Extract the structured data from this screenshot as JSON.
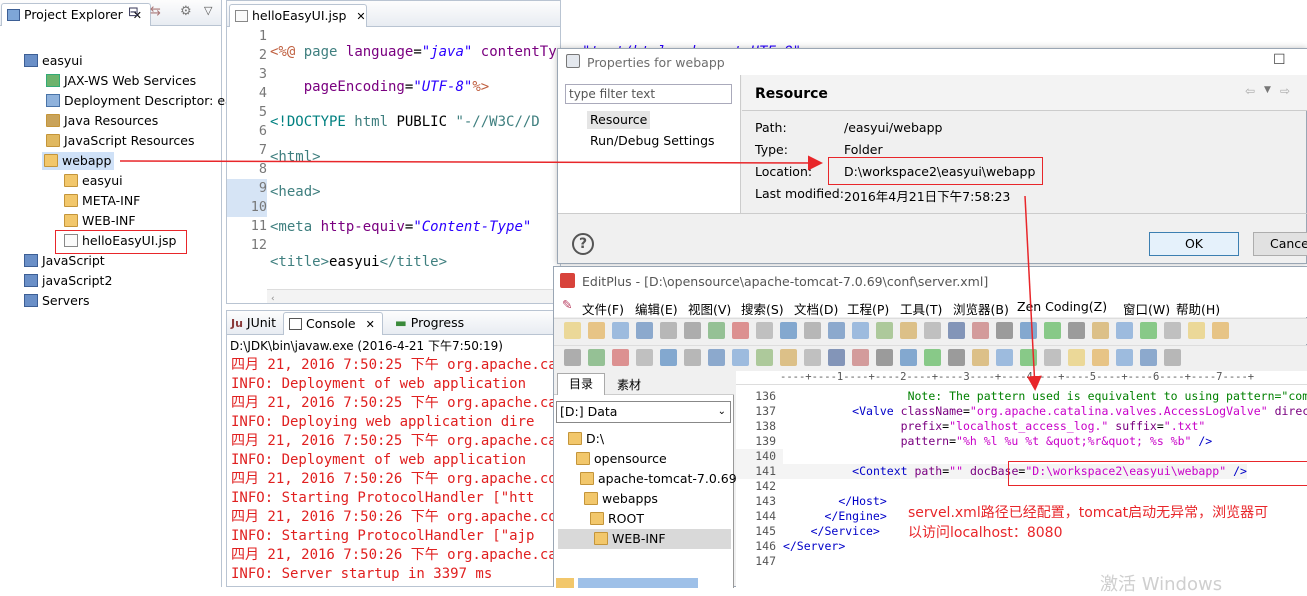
{
  "project_explorer": {
    "tab": "Project Explorer",
    "items": [
      {
        "label": "easyui",
        "icon": "project-icon"
      },
      {
        "label": "JAX-WS Web Services",
        "icon": "webservices-icon"
      },
      {
        "label": "Deployment Descriptor: ea",
        "icon": "descriptor-icon"
      },
      {
        "label": "Java Resources",
        "icon": "java-resources-icon"
      },
      {
        "label": "JavaScript Resources",
        "icon": "javascript-resources-icon"
      },
      {
        "label": "webapp",
        "icon": "folder-icon"
      },
      {
        "label": "easyui",
        "icon": "folder-icon"
      },
      {
        "label": "META-INF",
        "icon": "folder-icon"
      },
      {
        "label": "WEB-INF",
        "icon": "folder-icon"
      },
      {
        "label": "helloEasyUI.jsp",
        "icon": "jsp-file-icon"
      },
      {
        "label": "JavaScript",
        "icon": "project-icon"
      },
      {
        "label": "javaScript2",
        "icon": "project-icon"
      },
      {
        "label": "Servers",
        "icon": "project-icon"
      }
    ]
  },
  "editor": {
    "tab": "helloEasyUI.jsp",
    "line_numbers": [
      "1",
      "2",
      "3",
      "4",
      "5",
      "6",
      "7",
      "8",
      "9",
      "10",
      "11",
      "12"
    ]
  },
  "console_panel": {
    "tabs": [
      "JUnit",
      "Console",
      "Progress"
    ],
    "path": "D:\\JDK\\bin\\javaw.exe (2016-4-21 下午7:50:19)",
    "lines": [
      "四月 21, 2016 7:50:25 下午 org.apache.ca",
      "INFO: Deployment of web application",
      "四月 21, 2016 7:50:25 下午 org.apache.ca",
      "INFO: Deploying web application dire",
      "四月 21, 2016 7:50:25 下午 org.apache.ca",
      "INFO: Deployment of web application",
      "四月 21, 2016 7:50:26 下午 org.apache.co",
      "INFO: Starting ProtocolHandler [\"htt",
      "四月 21, 2016 7:50:26 下午 org.apache.co",
      "INFO: Starting ProtocolHandler [\"ajp",
      "四月 21, 2016 7:50:26 下午 org.apache.ca",
      "INFO: Server startup in 3397 ms"
    ]
  },
  "properties_dialog": {
    "title": "Properties for webapp",
    "filter_placeholder": "type filter text",
    "nav": [
      "Resource",
      "Run/Debug Settings"
    ],
    "section": "Resource",
    "fields": [
      {
        "label": "Path:",
        "value": "/easyui/webapp"
      },
      {
        "label": "Type:",
        "value": "Folder"
      },
      {
        "label": "Location:",
        "value": "D:\\workspace2\\easyui\\webapp"
      },
      {
        "label": "Last modified:",
        "value": "2016年4月21日下午7:58:23"
      }
    ],
    "ok": "OK",
    "cancel": "Cance",
    "help": "?"
  },
  "editplus": {
    "title": "EditPlus - [D:\\opensource\\apache-tomcat-7.0.69\\conf\\server.xml]",
    "menu": [
      "文件(F)",
      "编辑(E)",
      "视图(V)",
      "搜索(S)",
      "文档(D)",
      "工程(P)",
      "工具(T)",
      "浏览器(B)",
      "Zen Coding(Z)",
      "窗口(W)",
      "帮助(H)"
    ],
    "side_tabs": [
      "目录",
      "素材"
    ],
    "drive": "[D:] Data",
    "dirs": [
      "D:\\",
      "opensource",
      "apache-tomcat-7.0.69",
      "webapps",
      "ROOT",
      "WEB-INF"
    ],
    "ruler": "----+----1----+----2----+----3----+----4----+----5----+----6----+----7----+",
    "line_numbers": [
      "136",
      "137",
      "138",
      "139",
      "140",
      "141",
      "142",
      "143",
      "144",
      "145",
      "146",
      "147"
    ],
    "annotation_line1": "servel.xml路径已经配置，tomcat启动无异常，浏览器可",
    "annotation_line2": "以访问localhost：8080"
  },
  "watermark": "激活 Windows"
}
